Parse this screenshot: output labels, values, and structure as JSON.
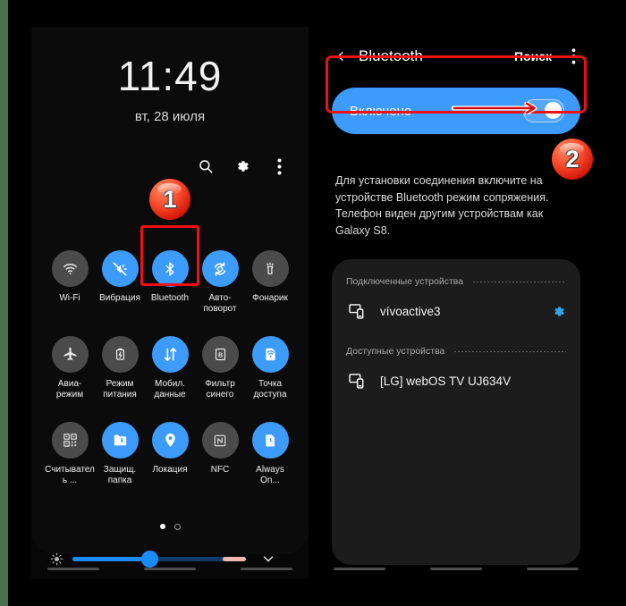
{
  "theme": {
    "accent_blue": "#3d9bfb",
    "highlight_red": "#ee1111",
    "panel_bg": "#0b0b0b",
    "card_bg": "#1c1c1c",
    "gear_blue": "#36a5e8",
    "slider_pink": "#efb8b0",
    "edge_green": "#4a7050"
  },
  "quick_panel": {
    "clock": "11:49",
    "date": "вт, 28 июля",
    "actions": [
      {
        "name": "search-icon",
        "label": "Поиск"
      },
      {
        "name": "gear-icon",
        "label": "Настройки"
      },
      {
        "name": "more-vert-icon",
        "label": "Ещё"
      }
    ],
    "tiles": [
      [
        {
          "label": "Wi-Fi",
          "icon": "wifi-icon",
          "state": "off"
        },
        {
          "label": "Вибрация",
          "icon": "vibration-icon",
          "state": "on"
        },
        {
          "label": "Bluetooth",
          "icon": "bluetooth-icon",
          "state": "on",
          "highlighted": true
        },
        {
          "label": "Авто-поворот",
          "icon": "auto-rotate-icon",
          "state": "on"
        },
        {
          "label": "Фонарик",
          "icon": "flashlight-icon",
          "state": "off"
        }
      ],
      [
        {
          "label": "Авиа-режим",
          "icon": "airplane-icon",
          "state": "off"
        },
        {
          "label": "Режим питания",
          "icon": "power-mode-icon",
          "state": "off"
        },
        {
          "label": "Мобил. данные",
          "icon": "mobile-data-icon",
          "state": "on"
        },
        {
          "label": "Фильтр синего",
          "icon": "blue-light-filter-icon",
          "state": "off"
        },
        {
          "label": "Точка доступа",
          "icon": "hotspot-icon",
          "state": "on"
        }
      ],
      [
        {
          "label": "Считыватель ...",
          "icon": "qr-scanner-icon",
          "state": "off"
        },
        {
          "label": "Защищ. папка",
          "icon": "secure-folder-icon",
          "state": "on"
        },
        {
          "label": "Локация",
          "icon": "location-icon",
          "state": "on"
        },
        {
          "label": "NFC",
          "icon": "nfc-icon",
          "state": "off"
        },
        {
          "label": "Always On...",
          "icon": "always-on-display-icon",
          "state": "on"
        }
      ]
    ],
    "page_dots": {
      "total": 2,
      "active": 1
    },
    "brightness": {
      "icon": "brightness-icon",
      "value_percent": 45,
      "expand_icon": "chevron-down-icon"
    }
  },
  "bluetooth_screen": {
    "back_icon": "chevron-left-icon",
    "title": "Bluetooth",
    "search_label": "Поиск",
    "menu_icon": "more-vert-icon",
    "toggle": {
      "label": "Включено",
      "state": "on"
    },
    "description": "Для установки соединения включите на устройстве Bluetooth режим сопряжения. Телефон виден другим устройствам как Galaxy S8.",
    "sections": [
      {
        "title": "Подключенные устройства",
        "devices": [
          {
            "name": "vívoactive3",
            "icon": "device-icon",
            "gear": true
          }
        ]
      },
      {
        "title": "Доступные устройства",
        "devices": [
          {
            "name": "[LG] webOS TV UJ634V",
            "icon": "device-icon",
            "gear": false
          }
        ]
      }
    ]
  },
  "annotations": {
    "badge_1": "1",
    "badge_2": "2"
  }
}
